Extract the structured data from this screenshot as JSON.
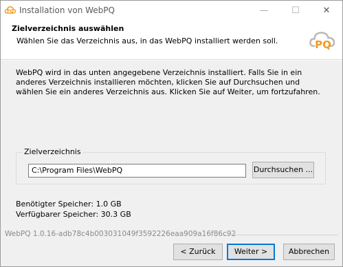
{
  "window": {
    "title": "Installation von WebPQ"
  },
  "header": {
    "title": "Zielverzeichnis auswählen",
    "subtitle": "Wählen Sie das Verzeichnis aus, in das WebPQ installiert werden soll.",
    "logo_text": "PQ"
  },
  "body": {
    "description": "WebPQ wird in das unten angegebene Verzeichnis installiert. Falls Sie in ein anderes Verzeichnis installieren möchten, klicken Sie auf Durchsuchen und wählen Sie ein anderes Verzeichnis aus. Klicken Sie auf Weiter, um fortzufahren.",
    "target_group_label": "Zielverzeichnis",
    "target_path": "C:\\Program Files\\WebPQ",
    "browse_label": "Durchsuchen ...",
    "required_space": "Benötigter Speicher: 1.0 GB",
    "available_space": "Verfügbarer Speicher: 30.3 GB"
  },
  "footer": {
    "branding": "WebPQ 1.0.16-adb78c4b003031049f3592226eaa909a16f86c92",
    "back_label": "< Zurück",
    "next_label": "Weiter >",
    "cancel_label": "Abbrechen"
  },
  "colors": {
    "accent": "#0078d7",
    "logo_orange": "#f39a1e"
  },
  "icons": {
    "app": "webpq-cloud-icon",
    "minimize": "minimize-icon",
    "maximize": "maximize-icon",
    "close": "close-icon"
  }
}
